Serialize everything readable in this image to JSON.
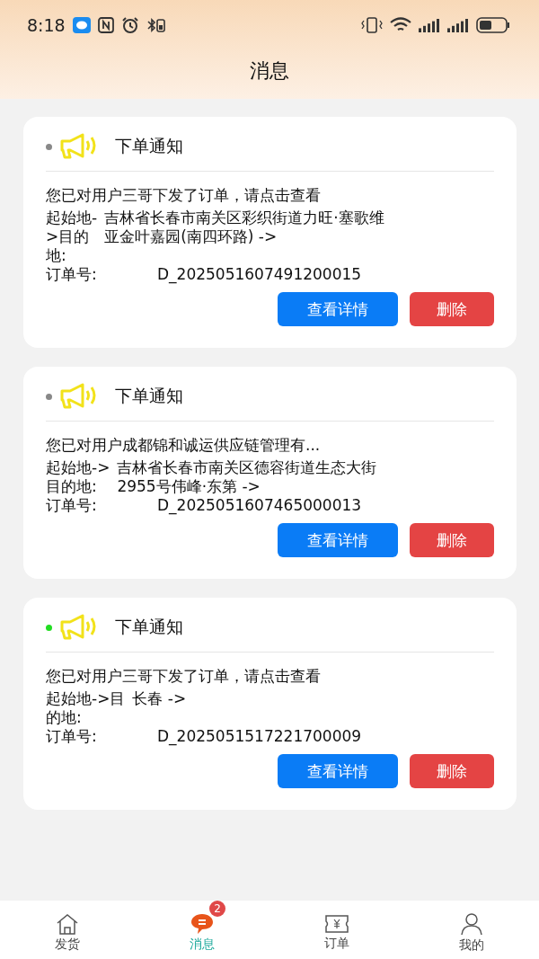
{
  "status_bar": {
    "time": "8:18"
  },
  "header": {
    "title": "消息"
  },
  "messages": [
    {
      "color": "#888888",
      "title": "下单通知",
      "summary": "您已对用户三哥下发了订单，请点击查看",
      "route_label_lines": [
        "起始地-",
        ">目的",
        "地:"
      ],
      "route_value_lines": [
        "吉林省长春市南关区彩织街道力旺·塞歌维",
        "亚金叶嘉园(南四环路) ->"
      ],
      "order_label": "订单号:",
      "order_no": "D_2025051607491200015",
      "buttons": [
        {
          "kind": "primary",
          "label": "查看详情"
        },
        {
          "kind": "danger",
          "label": "删除"
        }
      ]
    },
    {
      "color": "#888888",
      "title": "下单通知",
      "summary": "您已对用户成都锦和诚运供应链管理有...",
      "route_label_lines": [
        "起始地->",
        "目的地:"
      ],
      "route_value_lines": [
        "吉林省长春市南关区德容街道生态大街",
        "2955号伟峰·东第 ->"
      ],
      "order_label": "订单号:",
      "order_no": "D_2025051607465000013",
      "buttons": [
        {
          "kind": "primary",
          "label": "查看详情"
        },
        {
          "kind": "danger",
          "label": "删除"
        }
      ]
    },
    {
      "color": "#22dd22",
      "title": "下单通知",
      "summary": "您已对用户三哥下发了订单，请点击查看",
      "route_label_lines": [
        "起始地->目",
        "的地:"
      ],
      "route_value_lines": [
        "长春 ->"
      ],
      "order_label": "订单号:",
      "order_no": "D_2025051517221700009",
      "buttons": [
        {
          "kind": "primary",
          "label": "查看详情"
        },
        {
          "kind": "danger",
          "label": "删除"
        }
      ]
    }
  ],
  "tab_bar": [
    {
      "kind": "home",
      "label": "发货",
      "selected": false
    },
    {
      "kind": "message",
      "label": "消息",
      "selected": true,
      "badge": "2"
    },
    {
      "kind": "ticket",
      "label": "订单",
      "selected": false
    },
    {
      "kind": "user",
      "label": "我的",
      "selected": false
    }
  ]
}
